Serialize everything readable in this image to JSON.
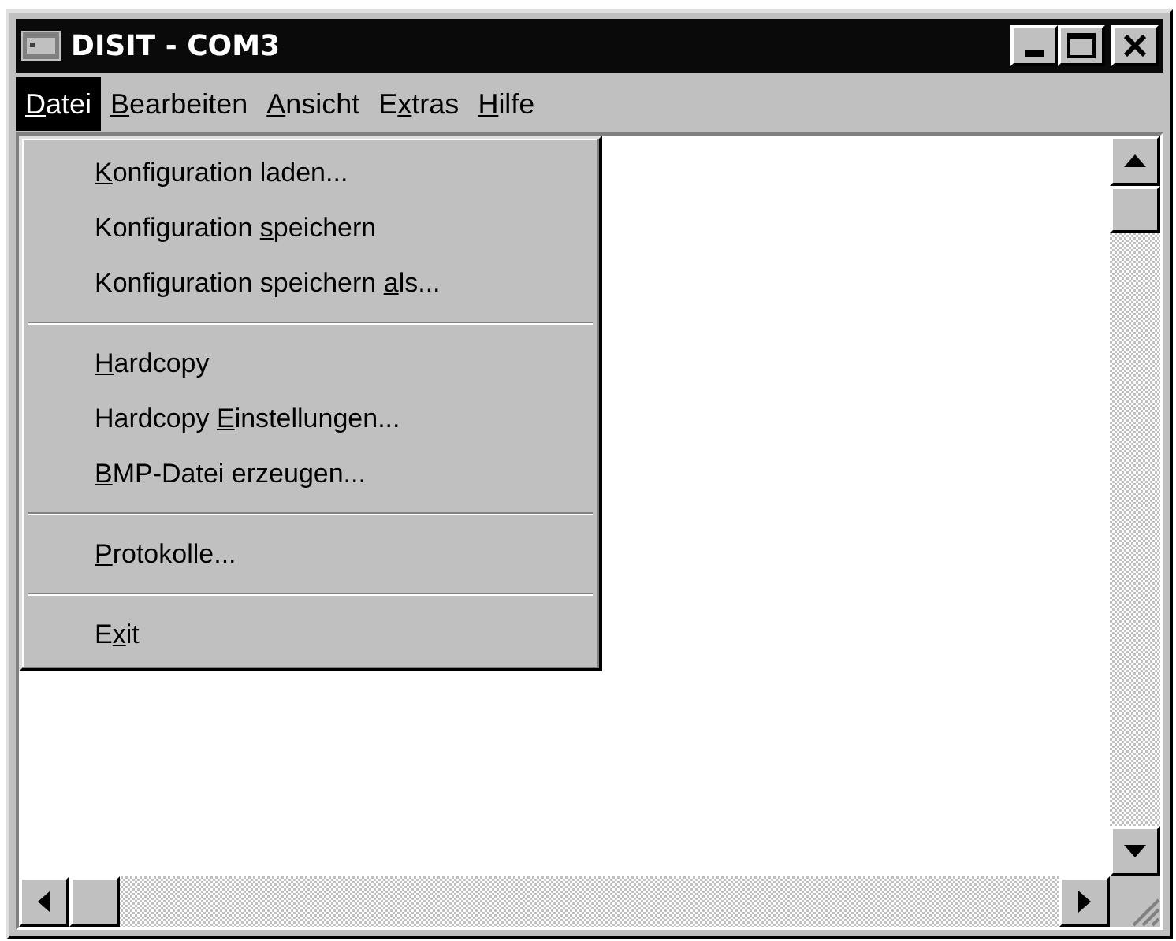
{
  "window": {
    "title": "DISIT - COM3"
  },
  "menu_bar": [
    {
      "key": "D",
      "post": "atei",
      "selected": true
    },
    {
      "key": "B",
      "post": "earbeiten",
      "selected": false
    },
    {
      "key": "A",
      "post": "nsicht",
      "selected": false
    },
    {
      "pre": "E",
      "key": "x",
      "post": "tras",
      "selected": false
    },
    {
      "key": "H",
      "post": "ilfe",
      "selected": false
    }
  ],
  "menu": {
    "groups": [
      [
        {
          "key": "K",
          "post": "onfiguration laden..."
        },
        {
          "pre": "Konfiguration ",
          "key": "s",
          "post": "peichern"
        },
        {
          "pre": "Konfiguration speichern ",
          "key": "a",
          "post": "ls..."
        }
      ],
      [
        {
          "key": "H",
          "post": "ardcopy"
        },
        {
          "pre": "Hardcopy ",
          "key": "E",
          "post": "instellungen..."
        },
        {
          "key": "B",
          "post": "MP-Datei erzeugen..."
        }
      ],
      [
        {
          "key": "P",
          "post": "rotokolle..."
        }
      ],
      [
        {
          "pre": "E",
          "key": "x",
          "post": "it"
        }
      ]
    ]
  }
}
